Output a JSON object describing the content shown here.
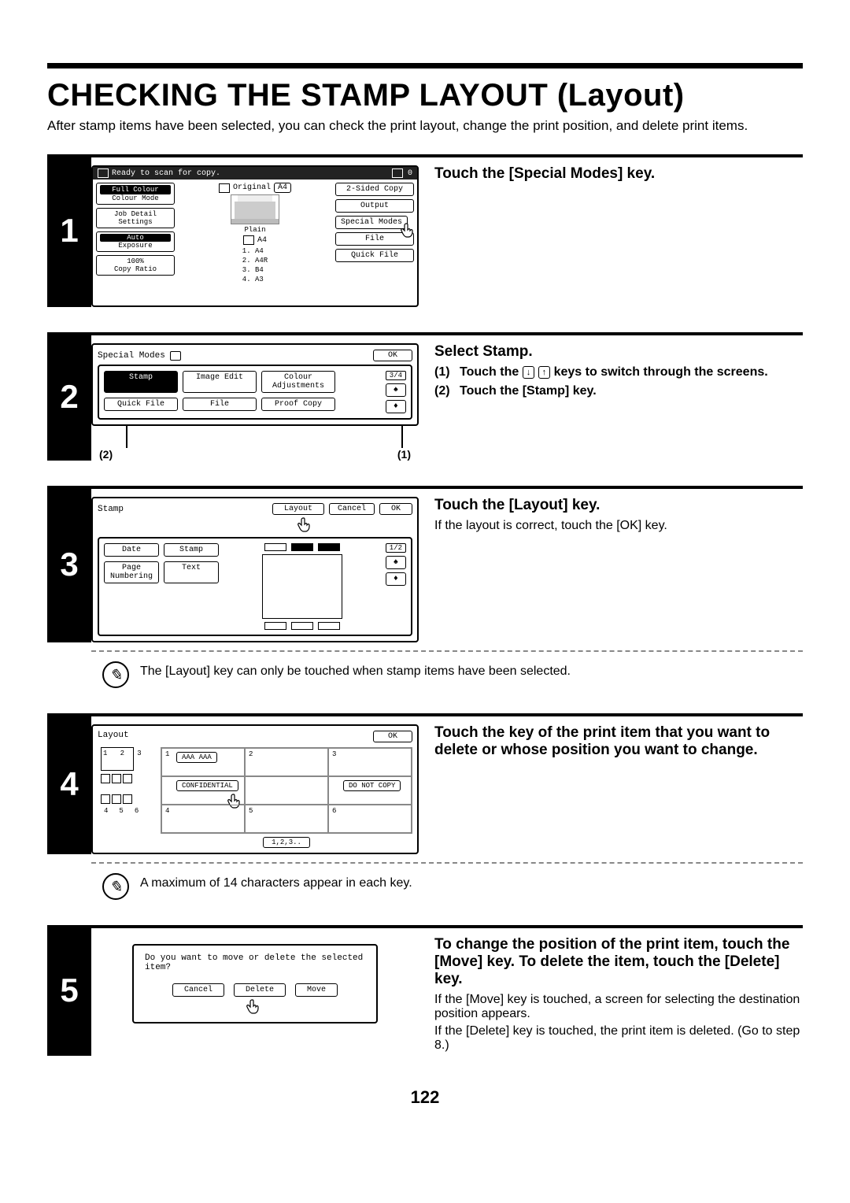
{
  "page": {
    "title": "CHECKING THE STAMP LAYOUT (Layout)",
    "intro": "After stamp items have been selected, you can check the print layout, change the print position, and delete print items.",
    "number": "122"
  },
  "step1": {
    "num": "1",
    "heading": "Touch the [Special Modes] key.",
    "screen": {
      "status": "Ready to scan for copy.",
      "counter": "0",
      "left": {
        "full_colour": "Full Colour",
        "colour_mode": "Colour Mode",
        "job_detail": "Job Detail Settings",
        "auto": "Auto",
        "exposure": "Exposure",
        "ratio_pct": "100%",
        "copy_ratio": "Copy Ratio"
      },
      "center": {
        "original": "Original",
        "original_size": "A4",
        "plain": "Plain",
        "paper_size": "A4",
        "sizes": [
          "1. A4",
          "2. A4R",
          "3. B4",
          "4. A3"
        ]
      },
      "right": {
        "twosided": "2-Sided Copy",
        "output": "Output",
        "special_modes": "Special Modes",
        "file": "File",
        "quick_file": "Quick File"
      }
    }
  },
  "step2": {
    "num": "2",
    "heading": "Select Stamp.",
    "sub1_num": "(1)",
    "sub1_a": "Touch the ",
    "sub1_b": " keys to switch through the screens.",
    "sub2_num": "(2)",
    "sub2": "Touch the [Stamp] key.",
    "key_down": "↓",
    "key_up": "↑",
    "screen": {
      "title": "Special Modes",
      "ok": "OK",
      "page": "3/4",
      "buttons": [
        "Stamp",
        "Image Edit",
        "Colour Adjustments",
        "Quick File",
        "File",
        "Proof Copy"
      ]
    },
    "callout_left": "(2)",
    "callout_right": "(1)"
  },
  "step3": {
    "num": "3",
    "heading": "Touch the [Layout] key.",
    "body": "If the layout is correct, touch the [OK] key.",
    "note": "The [Layout] key can only be touched when stamp items have been selected.",
    "screen": {
      "title": "Stamp",
      "layout": "Layout",
      "cancel": "Cancel",
      "ok": "OK",
      "page": "1/2",
      "left": [
        "Date",
        "Stamp",
        "Page Numbering",
        "Text"
      ]
    }
  },
  "step4": {
    "num": "4",
    "heading": "Touch the key of the print item that you want to delete or whose position you want to change.",
    "note": "A maximum of 14 characters appear in each key.",
    "screen": {
      "title": "Layout",
      "ok": "OK",
      "cells": {
        "c1": {
          "num": "1",
          "label": "AAA AAA"
        },
        "c2": {
          "num": "2"
        },
        "c3": {
          "num": "3"
        },
        "c4": {
          "num": "",
          "label": "CONFIDENTIAL"
        },
        "c5": {
          "num": ""
        },
        "c6": {
          "num": "",
          "label": "DO NOT COPY"
        },
        "c7": {
          "num": "4"
        },
        "c8": {
          "num": "5"
        },
        "c9": {
          "num": "6"
        }
      },
      "preview_nums": [
        "1",
        "2",
        "3",
        "4",
        "5",
        "6"
      ],
      "key125": "1,2,3.."
    }
  },
  "step5": {
    "num": "5",
    "heading": "To change the position of the print item, touch the [Move] key. To delete the item, touch the [Delete] key.",
    "body1": "If the [Move] key is touched, a screen for selecting the destination position appears.",
    "body2": "If the [Delete] key is touched, the print item is deleted. (Go to step 8.)",
    "screen": {
      "prompt": "Do you want to move or delete the selected item?",
      "cancel": "Cancel",
      "delete": "Delete",
      "move": "Move"
    }
  }
}
